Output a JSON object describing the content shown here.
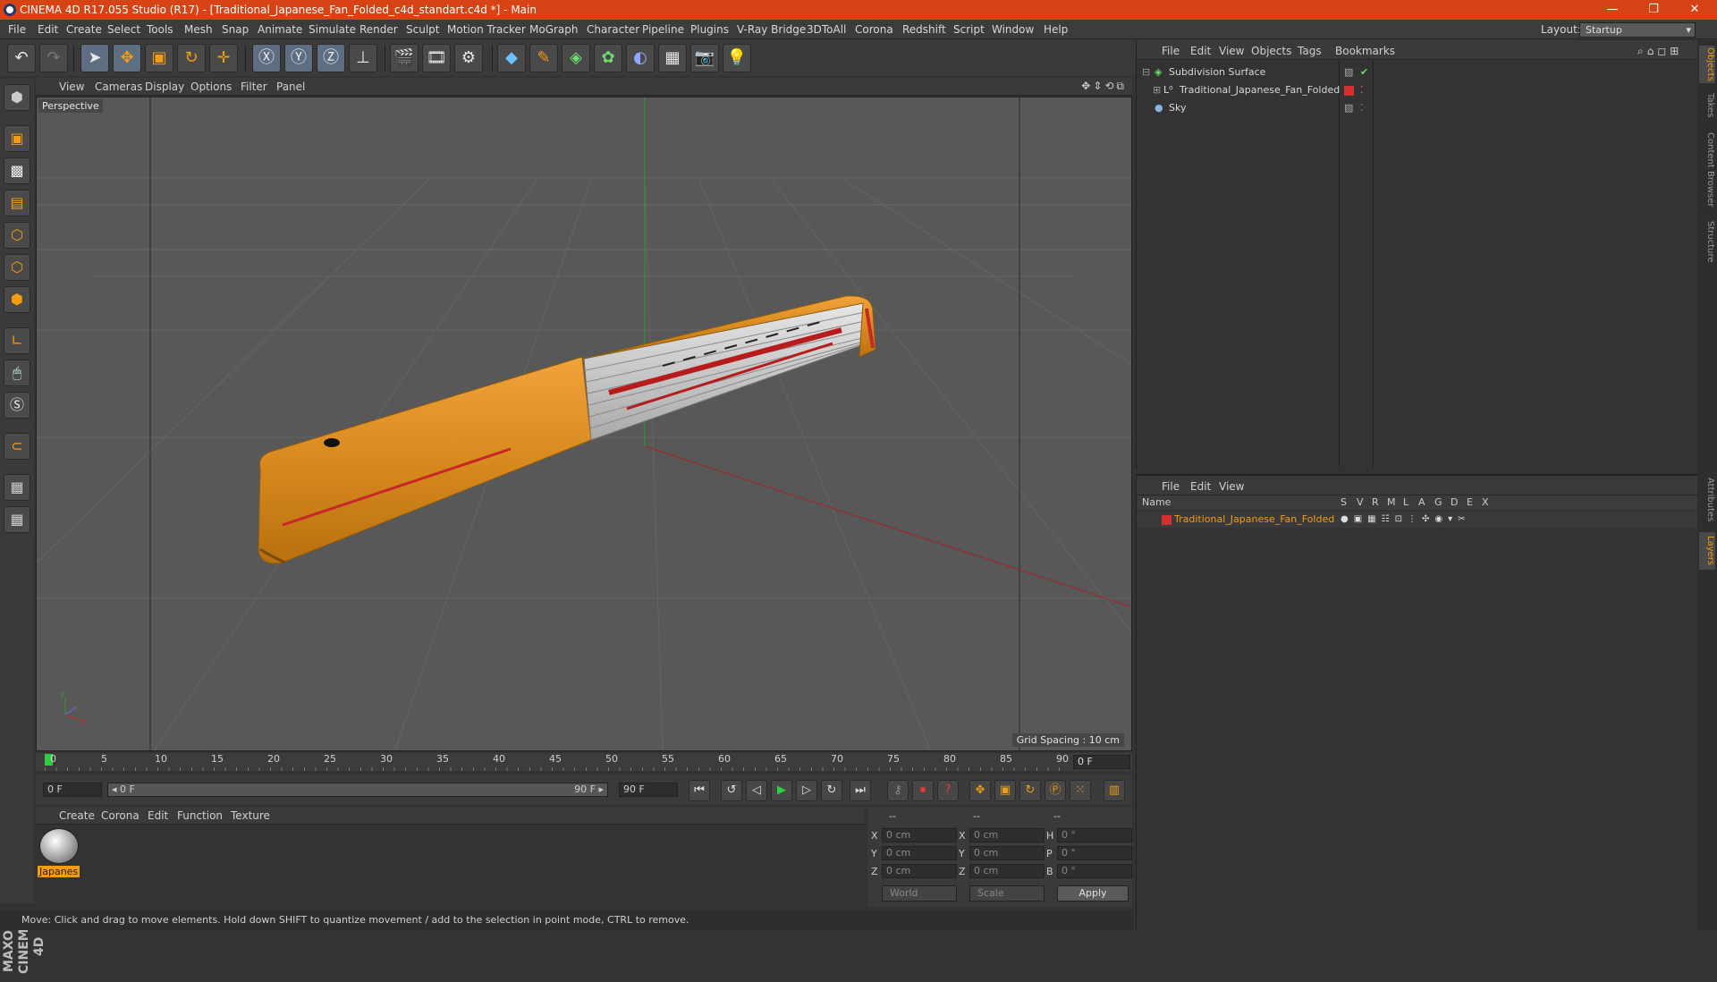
{
  "window": {
    "title": "CINEMA 4D R17.055 Studio (R17) - [Traditional_Japanese_Fan_Folded_c4d_standart.c4d *] - Main",
    "min": "—",
    "max": "❐",
    "close": "✕"
  },
  "menu": [
    "File",
    "Edit",
    "Create",
    "Select",
    "Tools",
    "Mesh",
    "Snap",
    "Animate",
    "Simulate",
    "Render",
    "Sculpt",
    "Motion Tracker",
    "MoGraph",
    "Character",
    "Pipeline",
    "Plugins",
    "V-Ray Bridge",
    "3DToAll",
    "Corona",
    "Redshift",
    "Script",
    "Window",
    "Help"
  ],
  "layout": {
    "label": "Layout:",
    "value": "Startup"
  },
  "viewport": {
    "menu": [
      "View",
      "Cameras",
      "Display",
      "Options",
      "Filter",
      "Panel"
    ],
    "label": "Perspective",
    "grid_spacing": "Grid Spacing : 10 cm"
  },
  "timeline": {
    "ticks": [
      "0",
      "5",
      "10",
      "15",
      "20",
      "25",
      "30",
      "35",
      "40",
      "45",
      "50",
      "55",
      "60",
      "65",
      "70",
      "75",
      "80",
      "85",
      "90"
    ],
    "end_field": "0 F",
    "start_field": "0 F",
    "range_start": "◂ 0 F",
    "range_end": "90 F ▸",
    "max_field": "90 F"
  },
  "materials": {
    "menu": [
      "Create",
      "Corona",
      "Edit",
      "Function",
      "Texture"
    ],
    "item_name": "Japanes"
  },
  "coords": {
    "header": [
      "--",
      "--",
      "--"
    ],
    "rows": [
      {
        "a": "X",
        "av": "0 cm",
        "b": "X",
        "bv": "0 cm",
        "c": "H",
        "cv": "0 °"
      },
      {
        "a": "Y",
        "av": "0 cm",
        "b": "Y",
        "bv": "0 cm",
        "c": "P",
        "cv": "0 °"
      },
      {
        "a": "Z",
        "av": "0 cm",
        "b": "Z",
        "bv": "0 cm",
        "c": "B",
        "cv": "0 °"
      }
    ],
    "world": "World",
    "scale": "Scale",
    "apply": "Apply"
  },
  "status": "Move: Click and drag to move elements. Hold down SHIFT to quantize movement / add to the selection in point mode, CTRL to remove.",
  "objects": {
    "menu": [
      "File",
      "Edit",
      "View",
      "Objects",
      "Tags",
      "Bookmarks"
    ],
    "items": [
      "Subdivision Surface",
      "Traditional_Japanese_Fan_Folded",
      "Sky"
    ]
  },
  "layers": {
    "menu": [
      "File",
      "Edit",
      "View"
    ],
    "columns": [
      "Name",
      "S",
      "V",
      "R",
      "M",
      "L",
      "A",
      "G",
      "D",
      "E",
      "X"
    ],
    "item": "Traditional_Japanese_Fan_Folded"
  },
  "side_tabs": [
    "Objects",
    "Takes",
    "Content Browser",
    "Structure",
    "Attributes",
    "Layers"
  ],
  "colors": {
    "title_bar": "#d84315",
    "accent": "#f39c12",
    "layer_red": "#d32f2f"
  }
}
